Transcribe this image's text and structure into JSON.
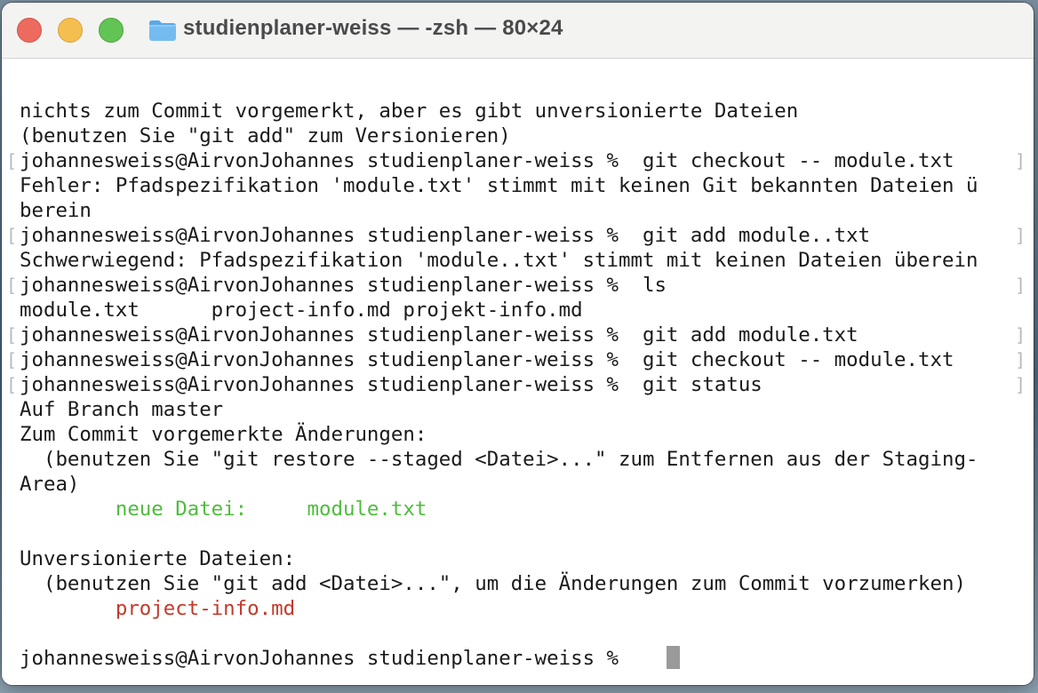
{
  "window": {
    "title": "studienplaner-weiss — -zsh — 80×24",
    "folder_icon": "folder-icon",
    "traffic_lights": {
      "close": "#ed6a5e",
      "minimize": "#f5bf4f",
      "zoom": "#61c454"
    }
  },
  "terminal": {
    "colors": {
      "text": "#1a1a1a",
      "staged": "#4fbc3c",
      "untracked": "#c4392a",
      "cursor": "#9a9a9a"
    },
    "lines": [
      "nichts zum Commit vorgemerkt, aber es gibt unversionierte Dateien",
      "(benutzen Sie \"git add\" zum Versionieren)",
      "johannesweiss@AirvonJohannes studienplaner-weiss %  git checkout -- module.txt",
      "Fehler: Pfadspezifikation 'module.txt' stimmt mit keinen Git bekannten Dateien ü",
      "berein",
      "johannesweiss@AirvonJohannes studienplaner-weiss %  git add module..txt",
      "Schwerwiegend: Pfadspezifikation 'module..txt' stimmt mit keinen Dateien überein",
      "johannesweiss@AirvonJohannes studienplaner-weiss %  ls",
      "module.txt      project-info.md projekt-info.md",
      "johannesweiss@AirvonJohannes studienplaner-weiss %  git add module.txt",
      "johannesweiss@AirvonJohannes studienplaner-weiss %  git checkout -- module.txt",
      "johannesweiss@AirvonJohannes studienplaner-weiss %  git status",
      "Auf Branch master",
      "Zum Commit vorgemerkte Änderungen:",
      "  (benutzen Sie \"git restore --staged <Datei>...\" zum Entfernen aus der Staging-",
      "Area)",
      "        neue Datei:     module.txt",
      "",
      "Unversionierte Dateien:",
      "  (benutzen Sie \"git add <Datei>...\", um die Änderungen zum Commit vorzumerken)",
      "        project-info.md",
      "",
      "johannesweiss@AirvonJohannes studienplaner-weiss % "
    ]
  }
}
